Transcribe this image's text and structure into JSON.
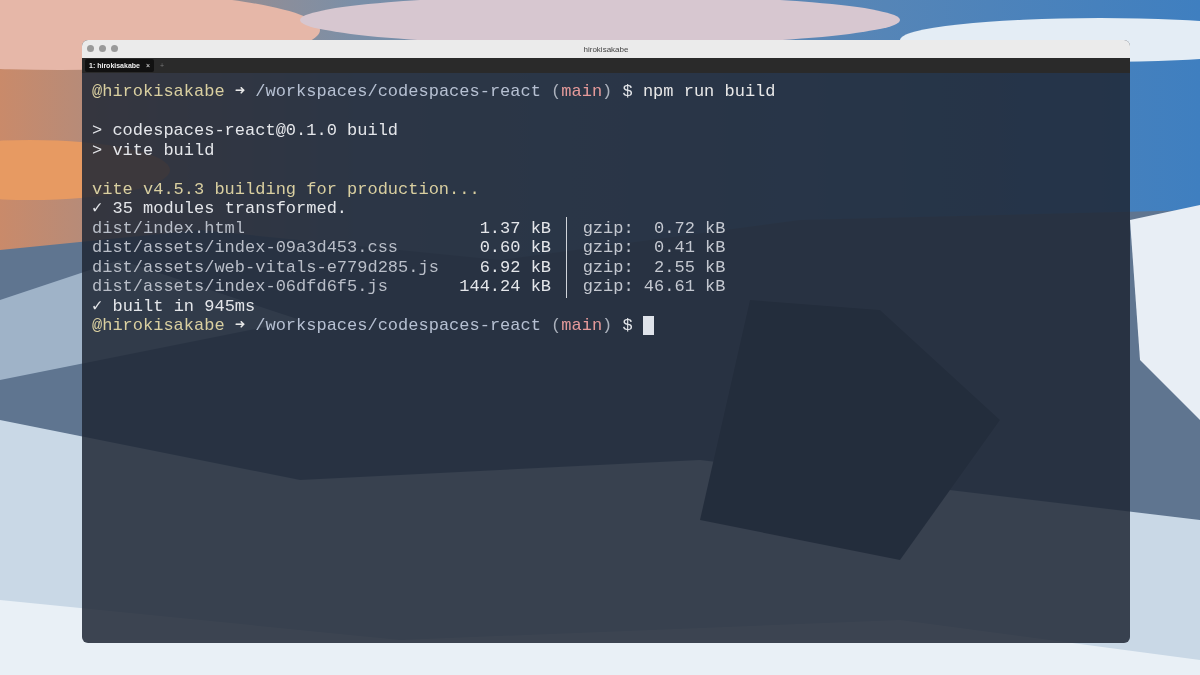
{
  "window": {
    "title": "hirokisakabe",
    "tabs": [
      {
        "label": "1: hirokisakabe",
        "close": "×",
        "selected": true
      }
    ],
    "new_tab": "+"
  },
  "terminal": {
    "lines": [
      {
        "kind": "prompt",
        "user": "@hirokisakabe",
        "arrow": "➜",
        "path": "/workspaces/codespaces-react",
        "branch_open": "(",
        "branch": "main",
        "branch_close": ")",
        "symbol": "$",
        "command": "npm run build",
        "cursor": false
      },
      {
        "kind": "blank"
      },
      {
        "kind": "output",
        "text": "> codespaces-react@0.1.0 build"
      },
      {
        "kind": "output",
        "text": "> vite build"
      },
      {
        "kind": "blank"
      },
      {
        "kind": "notice",
        "text": "vite v4.5.3 building for production..."
      },
      {
        "kind": "success",
        "mark": "✓",
        "text": "35 modules transformed."
      },
      {
        "kind": "asset",
        "file": "dist/index.html",
        "size": "1.37 kB",
        "gzip_label": "gzip:",
        "gzip": "0.72 kB"
      },
      {
        "kind": "asset",
        "file": "dist/assets/index-09a3d453.css",
        "size": "0.60 kB",
        "gzip_label": "gzip:",
        "gzip": "0.41 kB"
      },
      {
        "kind": "asset",
        "file": "dist/assets/web-vitals-e779d285.js",
        "size": "6.92 kB",
        "gzip_label": "gzip:",
        "gzip": "2.55 kB"
      },
      {
        "kind": "asset",
        "file": "dist/assets/index-06dfd6f5.js",
        "size": "144.24 kB",
        "gzip_label": "gzip:",
        "gzip": "46.61 kB"
      },
      {
        "kind": "success",
        "mark": "✓",
        "text": "built in 945ms"
      },
      {
        "kind": "prompt",
        "user": "@hirokisakabe",
        "arrow": "➜",
        "path": "/workspaces/codespaces-react",
        "branch_open": "(",
        "branch": "main",
        "branch_close": ")",
        "symbol": "$",
        "cursor": true
      }
    ]
  }
}
